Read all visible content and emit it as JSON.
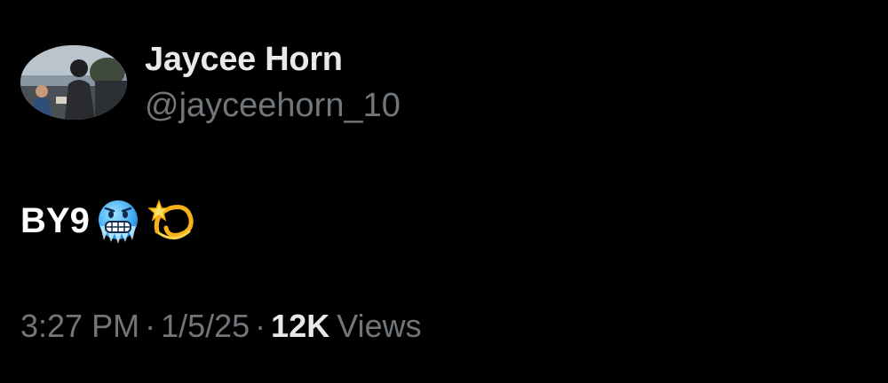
{
  "author": {
    "display_name": "Jaycee Horn",
    "handle": "@jayceehorn_10",
    "avatar_icon": "profile-photo"
  },
  "tweet": {
    "text": "BY9",
    "emojis": [
      {
        "name": "cold-face",
        "glyph": "🥶"
      },
      {
        "name": "dizzy",
        "glyph": "💫"
      }
    ]
  },
  "meta": {
    "time": "3:27 PM",
    "separator": "·",
    "date": "1/5/25",
    "views_count": "12K",
    "views_label": "Views"
  },
  "colors": {
    "background": "#000000",
    "primary_text": "#e7e9ea",
    "secondary_text": "#71767b"
  }
}
